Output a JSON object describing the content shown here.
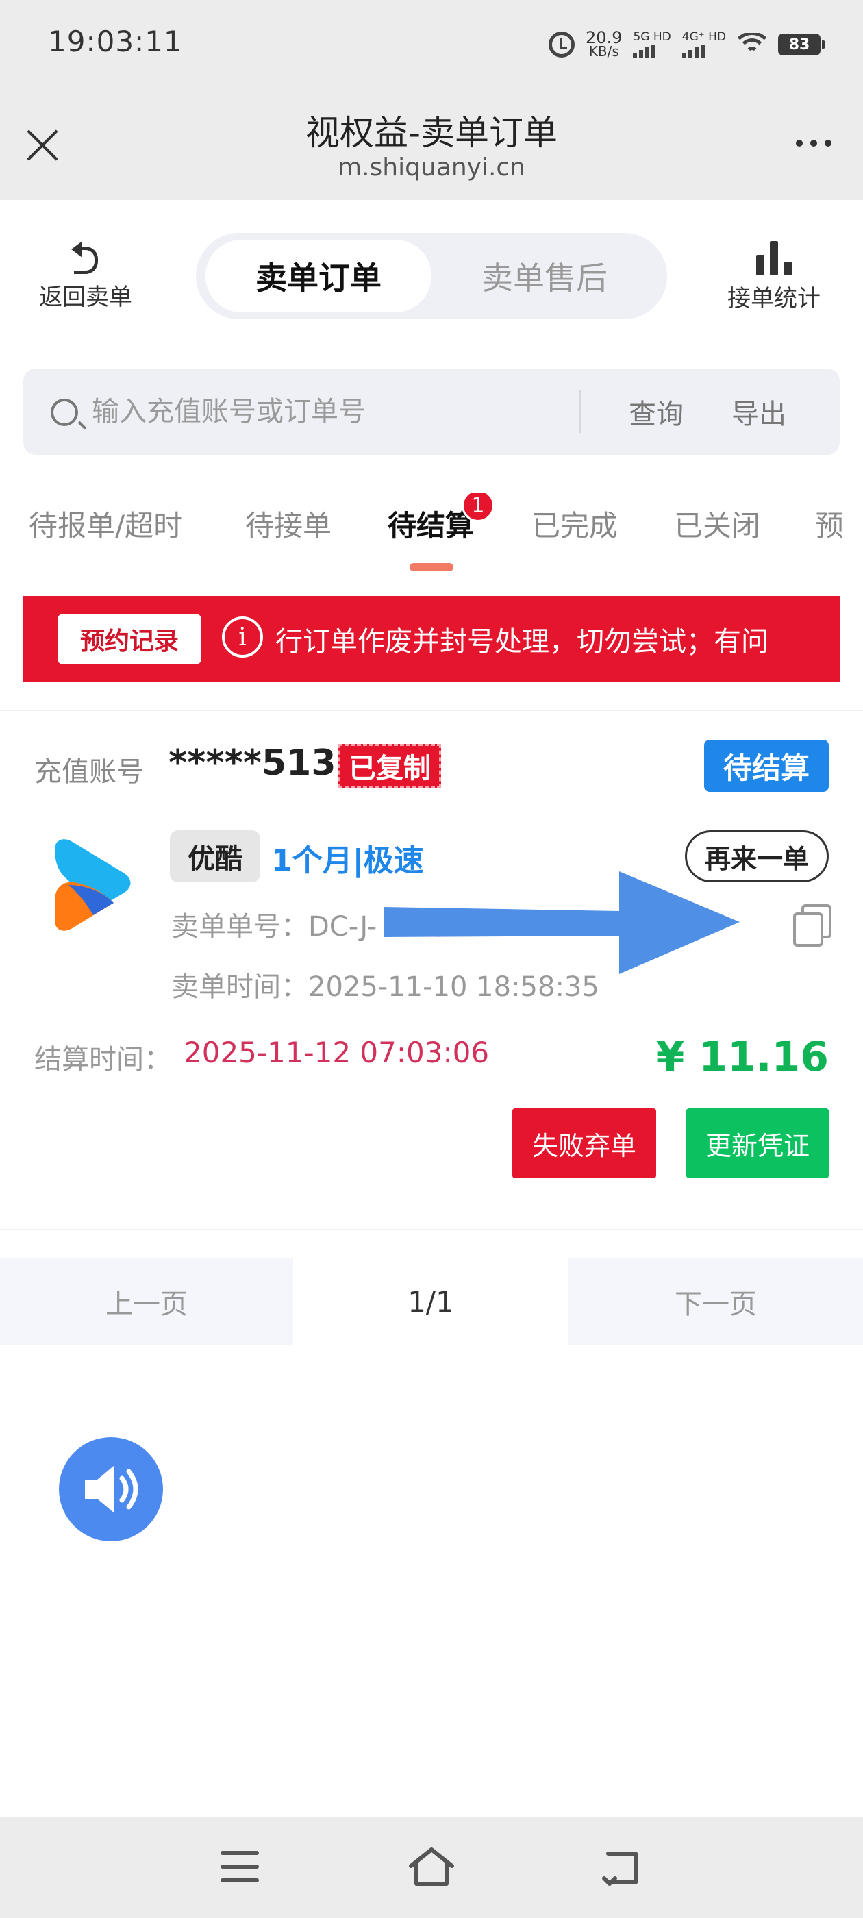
{
  "status_bar": {
    "time": "19:03:11",
    "net_speed_value": "20.9",
    "net_speed_unit": "KB/s",
    "sim1_label": "5G HD",
    "sim2_label": "4G⁺ HD",
    "battery": "83"
  },
  "browser": {
    "title": "视权益-卖单订单",
    "url": "m.shiquanyi.cn"
  },
  "header": {
    "back_label": "返回卖单",
    "segment_active": "卖单订单",
    "segment_inactive": "卖单售后",
    "stats_label": "接单统计"
  },
  "search": {
    "placeholder": "输入充值账号或订单号",
    "value": "",
    "query_label": "查询",
    "export_label": "导出"
  },
  "tabs": {
    "items": [
      "待报单/超时",
      "待接单",
      "待结算",
      "已完成",
      "已关闭",
      "预"
    ],
    "active_index": 2,
    "badge_count": "1"
  },
  "notice": {
    "button_label": "预约记录",
    "text": "行订单作废并封号处理，切勿尝试；有问"
  },
  "order": {
    "account_label": "充值账号",
    "account_value": "*****513",
    "copied_tag": "已复制",
    "status": "待结算",
    "platform_tag": "优酷",
    "product_name": "1个月|极速",
    "again_label": "再来一单",
    "order_no_label": "卖单单号：",
    "order_no_value": "DC-J-",
    "order_time_label": "卖单时间：",
    "order_time_value": "2025-11-10 18:58:35",
    "settle_label": "结算时间：",
    "settle_value": "2025-11-12 07:03:06",
    "price": "¥ 11.16",
    "fail_label": "失败弃单",
    "update_label": "更新凭证"
  },
  "pager": {
    "prev_label": "上一页",
    "current": "1/1",
    "next_label": "下一页"
  },
  "colors": {
    "brand_red": "#e4152c",
    "status_blue": "#1f86ea",
    "price_green": "#10b457",
    "settle_time_red": "#d1315a",
    "speaker_blue": "#4d8af0"
  },
  "icons": {
    "close": "close-icon",
    "more": "more-dots-icon",
    "back": "undo-arrow-icon",
    "stats": "bar-chart-icon",
    "search": "search-icon",
    "info": "info-icon",
    "copy": "copy-icon",
    "speaker": "speaker-icon",
    "nav_menu": "menu-icon",
    "nav_home": "home-icon",
    "nav_back": "back-icon"
  }
}
